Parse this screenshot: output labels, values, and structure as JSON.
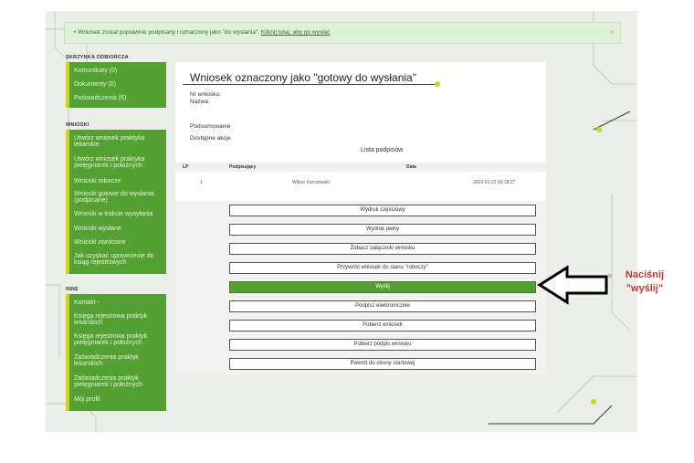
{
  "notice": {
    "text": "• Wniosek został poprawnie podpisany i oznaczony jako \"do wysłania\".",
    "link": "Kliknij tutaj, aby go wysłać"
  },
  "inbox": {
    "heading": "SKRZYNKA ODBIORCZA",
    "items": [
      "Komunikaty (0)",
      "Dokumenty (0)",
      "Poświadczenia (6)"
    ]
  },
  "wnioski": {
    "heading": "WNIOSKI",
    "items": [
      [
        "Utwórz wniosek praktyka",
        "lekarskie"
      ],
      [
        "Utwórz wniosek praktyka",
        "pielęgniarek i położnych"
      ],
      [
        "Wnioski robocze"
      ],
      [
        "Wnioski gotowe do wysłania",
        "(podpisane)"
      ],
      [
        "Wnioski w trakcie wysyłania"
      ],
      [
        "Wnioski wysłane"
      ],
      [
        "Wnioski zwrócone"
      ],
      [
        "Jak uzyskać uprawnienie do",
        "ksiąg rejestrowych"
      ]
    ]
  },
  "inne": {
    "heading": "INNE",
    "items": [
      [
        "Kontakt -"
      ],
      [
        "Księga rejestrowa praktyk",
        "lekarskich"
      ],
      [
        "Księga rejestrowa praktyk",
        "pielęgniarek i położnych"
      ],
      [
        "Zaświadczenia praktyk",
        "lekarskich"
      ],
      [
        "Zaświadczenia praktyk",
        "pielęgniarek i położnych"
      ],
      [
        "Mój profil"
      ]
    ]
  },
  "main": {
    "title": "Wniosek oznaczony jako \"gotowy do wysłania\"",
    "nr_label": "Nr wniosku:",
    "name_label": "Nazwa:",
    "summary_label": "Podsumowanie",
    "actions_label": "Dostępne akcje",
    "sign_list_title": "Lista podpisów",
    "table": {
      "headers": [
        "LP",
        "Podpisujący",
        "Data"
      ],
      "rows": [
        [
          "1",
          "Wiktor Karczewski",
          "2019-01-22 09:18:27"
        ]
      ]
    },
    "buttons": [
      "Wydruk częściowy",
      "Wydruk pełny",
      "Zobacz załączniki wniosku",
      "Przywróć wniosek do stanu \"roboczy\"",
      "Wyślij",
      "Podpisz elektronicznie",
      "Pobierz wniosek",
      "Pobierz podpis wniosku",
      "Powrót do strony startowej"
    ],
    "active_button_index": 4
  },
  "annotation": {
    "line1": "Naciśnij",
    "line2": "\"wyślij\""
  },
  "colors": {
    "accent_green": "#55a032",
    "accent_yellow": "#c9d520",
    "annotation_red": "#c0392b"
  }
}
